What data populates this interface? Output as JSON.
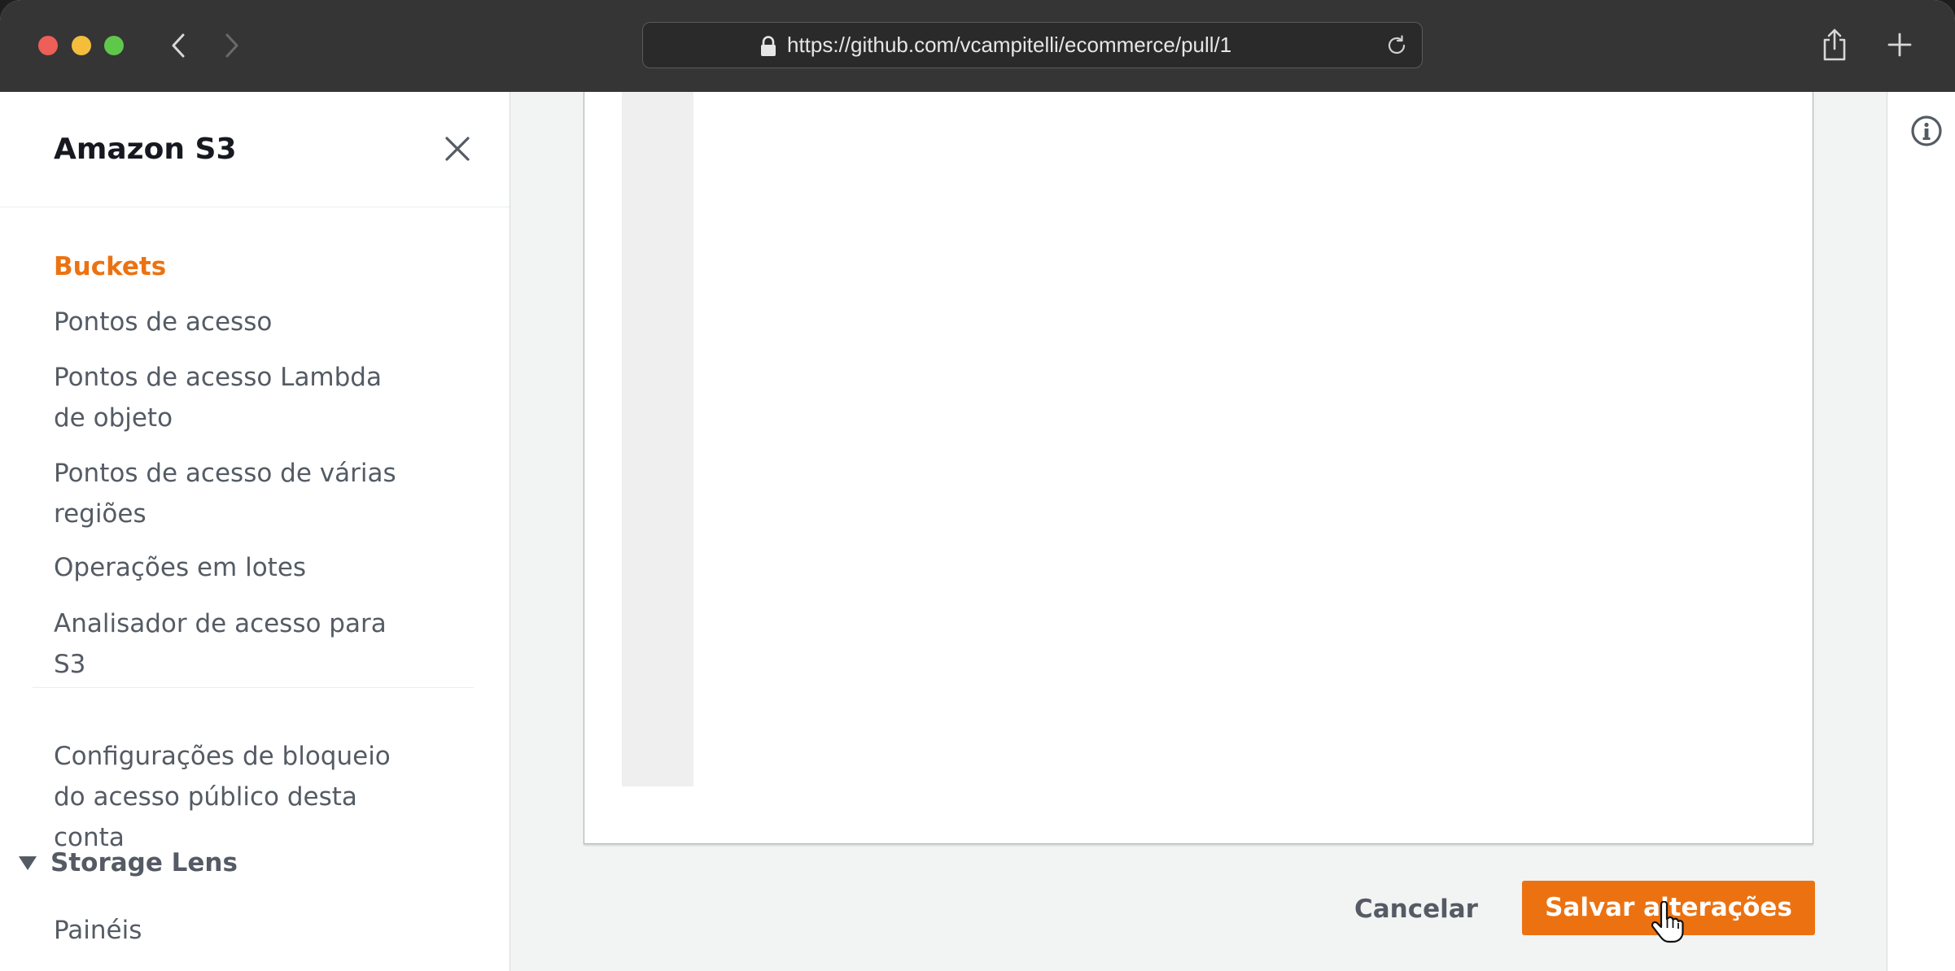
{
  "browser": {
    "url": "https://github.com/vcampitelli/ecommerce/pull/1",
    "icons": {
      "back": "chevron-left-icon",
      "forward": "chevron-right-icon",
      "lock": "lock-icon",
      "reload": "reload-icon",
      "share": "share-icon",
      "new_tab": "plus-icon"
    }
  },
  "sidebar": {
    "title": "Amazon S3",
    "close_icon": "close-icon",
    "items": [
      {
        "label": "Buckets",
        "active": true
      },
      {
        "label": "Pontos de acesso"
      },
      {
        "label": "Pontos de acesso Lambda de objeto"
      },
      {
        "label": "Pontos de acesso de várias regiões"
      },
      {
        "label": "Operações em lotes"
      },
      {
        "label": "Analisador de acesso para S3"
      }
    ],
    "secondary_items": [
      {
        "label": "Configurações de bloqueio do acesso público desta conta"
      }
    ],
    "section": {
      "label": "Storage Lens",
      "expanded": true,
      "items": [
        {
          "label": "Painéis"
        }
      ]
    }
  },
  "main": {
    "cancel_label": "Cancelar",
    "save_label": "Salvar alterações"
  },
  "rail": {
    "info_icon": "info-icon"
  },
  "colors": {
    "accent": "#ec7211",
    "chrome": "#353535",
    "text": "#545b64"
  }
}
